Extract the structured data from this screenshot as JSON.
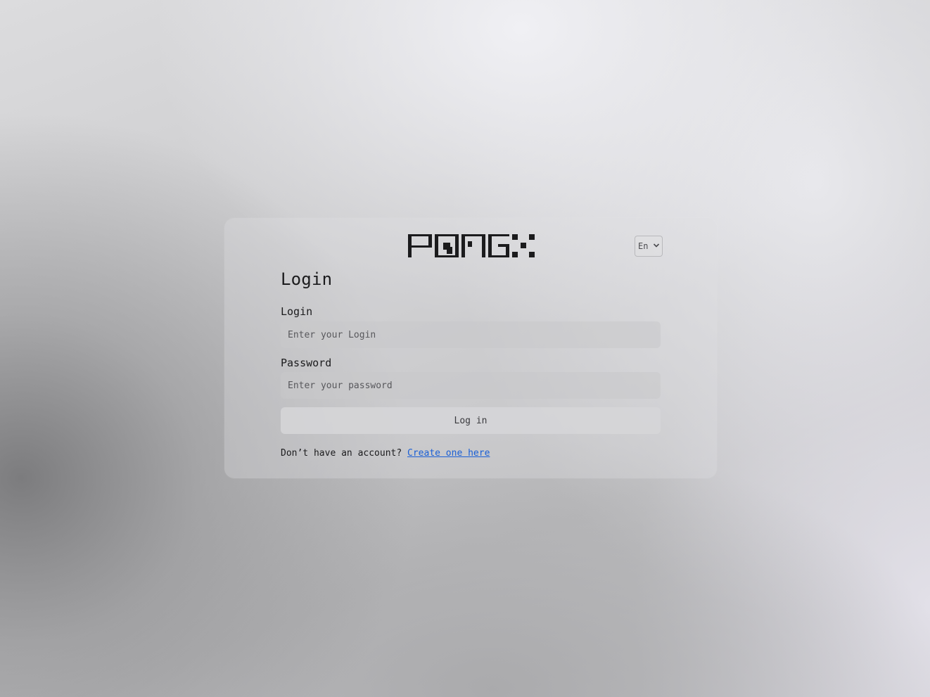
{
  "brand": {
    "logo_icon": "pongx-pixel-logo"
  },
  "language": {
    "selected": "En",
    "icon": "chevron-down-icon"
  },
  "form": {
    "title": "Login",
    "login_label": "Login",
    "login_placeholder": "Enter your Login",
    "password_label": "Password",
    "password_placeholder": "Enter your password",
    "submit_label": "Log in",
    "signup_prompt": "Don’t have an account?",
    "signup_link": "Create one here"
  },
  "colors": {
    "link": "#1a5fd6",
    "text": "#1b1b1d"
  }
}
